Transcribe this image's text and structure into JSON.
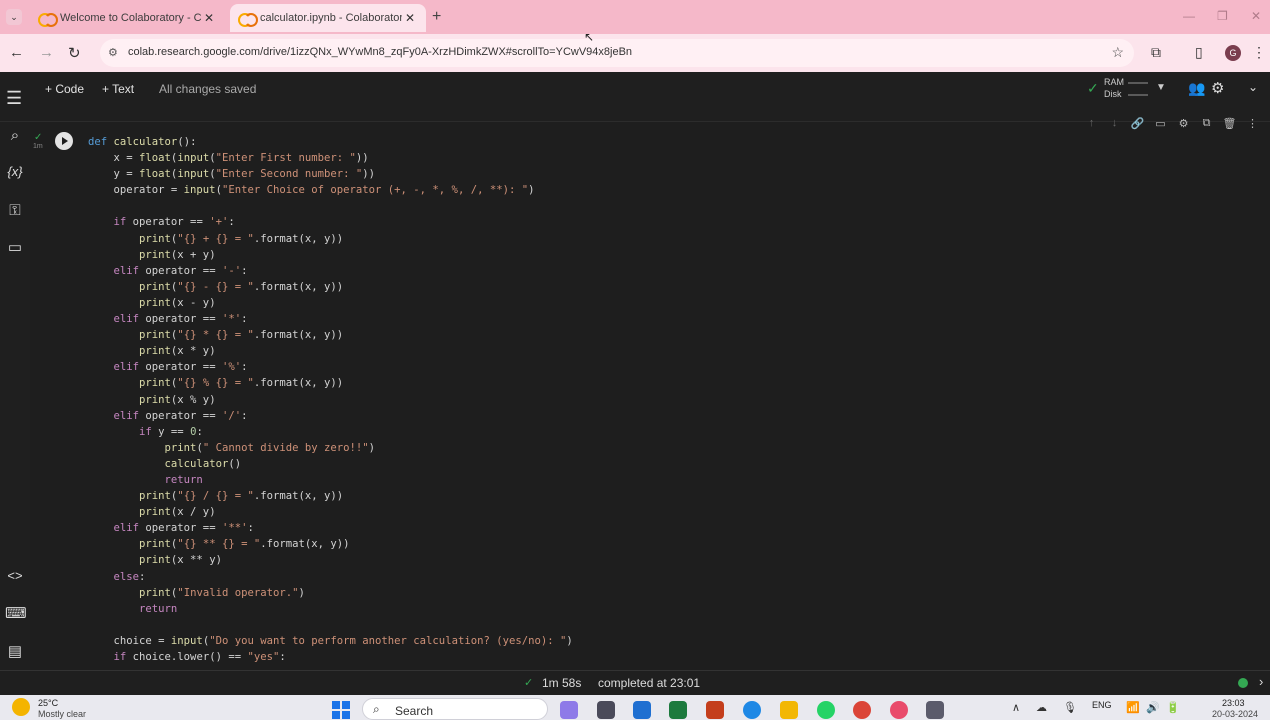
{
  "browser": {
    "tabs": [
      {
        "title": "Welcome to Colaboratory - Co",
        "active": false
      },
      {
        "title": "calculator.ipynb - Colaboratory",
        "active": true
      }
    ],
    "url": "colab.research.google.com/drive/1izzQNx_WYwMn8_zqFy0A-XrzHDimkZWX#scrollTo=YCwV94x8jeBn",
    "profile_initial": "G",
    "window_controls": [
      "—",
      "❐",
      "✕"
    ]
  },
  "toolbar": {
    "code_label": "+ Code",
    "text_label": "+ Text",
    "save_status": "All changes saved",
    "ram_label": "RAM",
    "disk_label": "Disk"
  },
  "cell": {
    "exec_time": "1m"
  },
  "status": {
    "duration": "1m 58s",
    "completed": "completed at 23:01"
  },
  "taskbar": {
    "temperature": "25°C",
    "weather": "Mostly clear",
    "search_label": "Search",
    "language": "ENG",
    "time": "23:03",
    "date": "20-03-2024"
  },
  "colors": {
    "tab_strip": "#f5b8c9",
    "editor_bg": "#1e1e1e",
    "keyword": "#569cd6",
    "string": "#ce9178",
    "ok_green": "#34a853"
  }
}
